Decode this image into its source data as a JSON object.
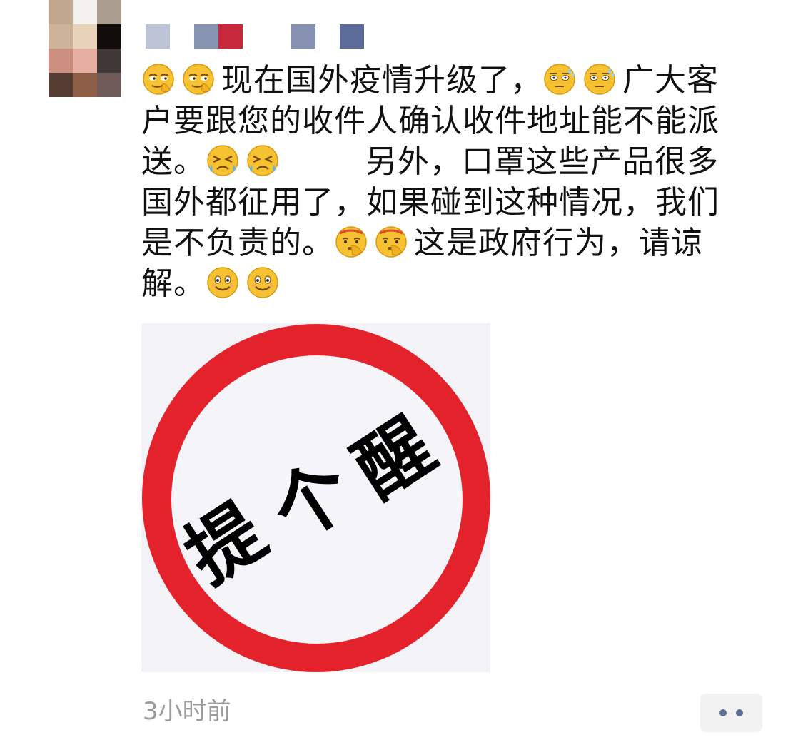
{
  "post": {
    "avatar_colors": [
      "#c2a78f",
      "#f4f2ee",
      "#a89d8f",
      "#cdb39a",
      "#e6d3b9",
      "#120c0a",
      "#cd8f7f",
      "#e5aea3",
      "#3f3837",
      "#563d34",
      "#8f5e46",
      "#6e5a59"
    ],
    "nickname_colors": [
      "#bcc3d6",
      "#8795b3",
      "#c7283a",
      "#8792b2",
      "#5b6c9a"
    ],
    "text_lines": [
      [
        "emoji:smirk",
        "emoji:smirk",
        "现在国外疫情升级了，",
        "emoji:sweat",
        "emoji:sweat",
        "广大客"
      ],
      [
        "户要跟您的收件人确认收件地址能不能派"
      ],
      [
        "送。",
        "emoji:cry",
        "emoji:cry",
        "gap",
        "另外，口罩这些产品很多"
      ],
      [
        "国外都征用了，如果碰到这种情况，我们"
      ],
      [
        "是不负责的。",
        "emoji:salute",
        "emoji:salute",
        "这是政府行为，请谅"
      ],
      [
        "解。",
        "emoji:smile",
        "emoji:smile"
      ]
    ],
    "image": {
      "text_chars": [
        "提",
        "个",
        "醒"
      ],
      "ring_color": "#e4222b",
      "bg_color": "#f3f2f6"
    },
    "timestamp": "3小时前",
    "more_button_icon": "more-dots-icon"
  }
}
